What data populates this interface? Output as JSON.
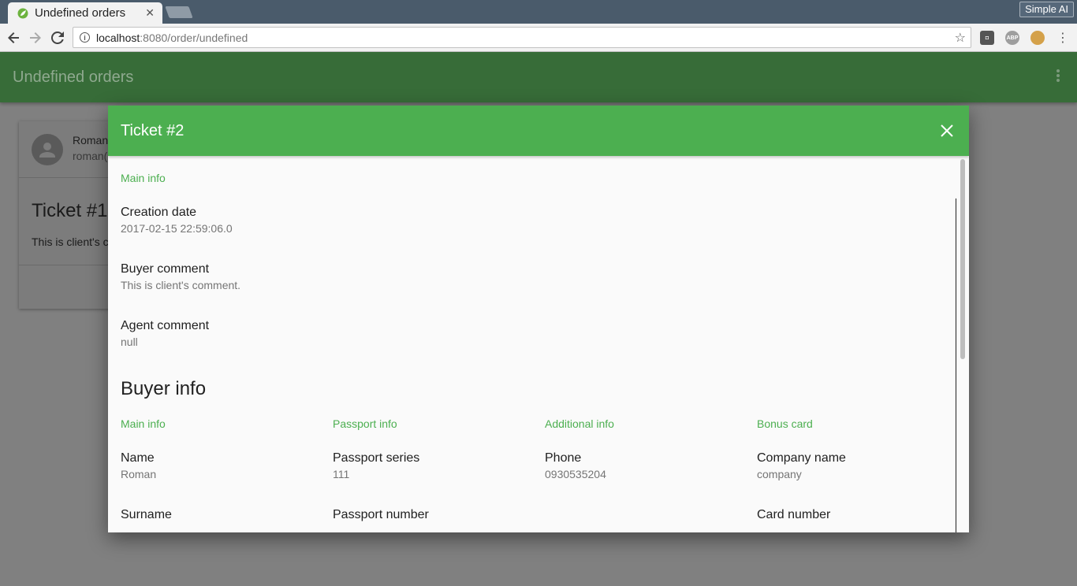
{
  "browser": {
    "tab_title": "Undefined orders",
    "tab_close": "✕",
    "profile_name": "Simple AI",
    "url_host": "localhost",
    "url_rest": ":8080/order/undefined"
  },
  "app": {
    "title": "Undefined orders"
  },
  "background_card": {
    "user_name": "Roman",
    "user_email": "roman(",
    "ticket_title": "Ticket #1",
    "comment": "This is client's c"
  },
  "dialog": {
    "title": "Ticket #2",
    "main_info": {
      "subheader": "Main info",
      "items": [
        {
          "label": "Creation date",
          "value": "2017-02-15 22:59:06.0"
        },
        {
          "label": "Buyer comment",
          "value": "This is client's comment."
        },
        {
          "label": "Agent comment",
          "value": "null"
        }
      ]
    },
    "buyer_info": {
      "title": "Buyer info",
      "columns": [
        {
          "subheader": "Main info",
          "items": [
            {
              "label": "Name",
              "value": "Roman"
            },
            {
              "label": "Surname",
              "value": ""
            }
          ]
        },
        {
          "subheader": "Passport info",
          "items": [
            {
              "label": "Passport series",
              "value": "111"
            },
            {
              "label": "Passport number",
              "value": ""
            }
          ]
        },
        {
          "subheader": "Additional info",
          "items": [
            {
              "label": "Phone",
              "value": "0930535204"
            }
          ]
        },
        {
          "subheader": "Bonus card",
          "items": [
            {
              "label": "Company name",
              "value": "company"
            },
            {
              "label": "Card number",
              "value": ""
            }
          ]
        }
      ]
    }
  },
  "colors": {
    "accent": "#4caf50",
    "appbar": "#376c38",
    "overlay": "#808080"
  }
}
